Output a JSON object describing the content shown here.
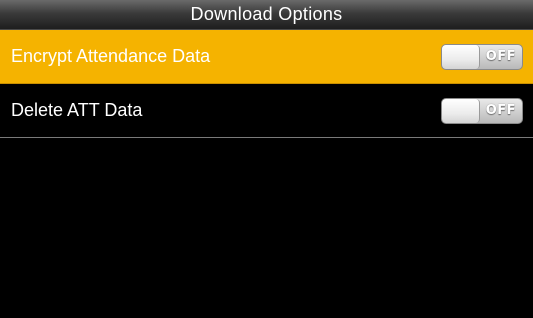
{
  "screen": {
    "title": "Download Options"
  },
  "menu": {
    "items": [
      {
        "label": "Encrypt Attendance Data",
        "toggle": "OFF",
        "selected": true
      },
      {
        "label": "Delete ATT Data",
        "toggle": "OFF",
        "selected": false
      }
    ]
  },
  "colors": {
    "background": "#000000",
    "selected_row": "#f5b300",
    "title_bar": "#3b3b3b",
    "text": "#ffffff"
  }
}
